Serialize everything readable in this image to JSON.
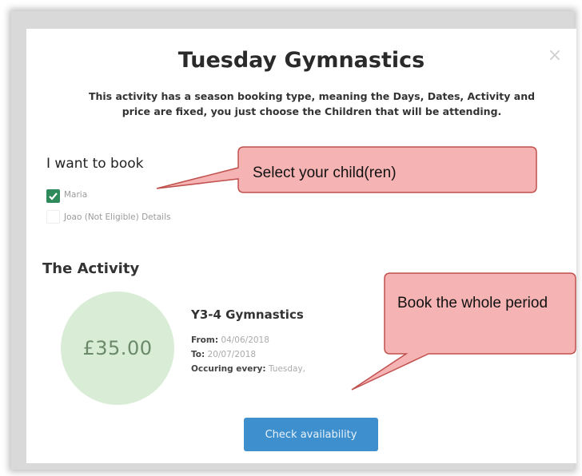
{
  "modal": {
    "title": "Tuesday Gymnastics",
    "description": "This activity has a season booking type, meaning the Days, Dates, Activity and price are fixed, you just choose the Children that will be attending.",
    "close_glyph": "×"
  },
  "booking": {
    "heading": "I want to book",
    "children": [
      {
        "label": "Maria",
        "checked": true
      },
      {
        "label": "Joao (Not Eligible) Details",
        "checked": false
      }
    ]
  },
  "activity": {
    "heading": "The Activity",
    "price": "£35.00",
    "name": "Y3-4 Gymnastics",
    "from_label": "From:",
    "from_value": "04/06/2018",
    "to_label": "To:",
    "to_value": "20/07/2018",
    "occurring_label": "Occuring every:",
    "occurring_value": "Tuesday,"
  },
  "actions": {
    "check_availability": "Check availability"
  },
  "callouts": {
    "select_children": "Select your child(ren)",
    "book_period": "Book the whole period"
  },
  "colors": {
    "checkbox": "#2f8a5b",
    "price_circle": "#d9ecd6",
    "button": "#3d8fcd",
    "callout_fill": "#f5b3b3",
    "callout_border": "#c0504d"
  }
}
